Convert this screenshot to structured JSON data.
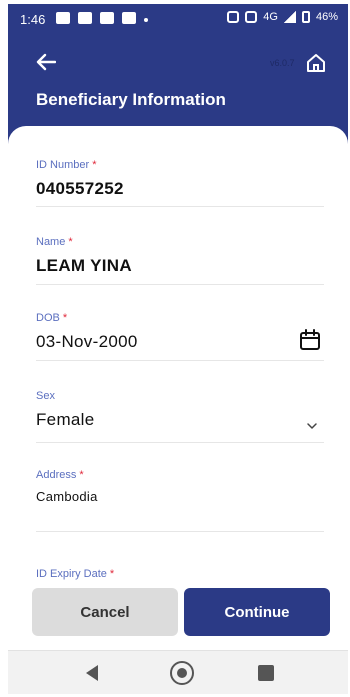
{
  "status": {
    "time": "1:46",
    "signal_text": "4G",
    "battery_text": "46%"
  },
  "appbar": {
    "version": "v6.0.7",
    "title": "Beneficiary Information"
  },
  "fields": {
    "id_number": {
      "label": "ID Number",
      "required": "*",
      "value": "040557252"
    },
    "name": {
      "label": "Name",
      "required": "*",
      "value": "LEAM YINA"
    },
    "dob": {
      "label": "DOB",
      "required": "*",
      "value": "03-Nov-2000"
    },
    "sex": {
      "label": "Sex",
      "value": "Female"
    },
    "address": {
      "label": "Address",
      "required": "*",
      "value": "Cambodia"
    },
    "id_expiry": {
      "label": "ID Expiry Date",
      "required": "*"
    }
  },
  "buttons": {
    "cancel": "Cancel",
    "continue": "Continue"
  },
  "icons": {
    "back": "arrow-left-icon",
    "home": "home-icon",
    "calendar": "calendar-icon",
    "dropdown": "chevron-down-icon"
  },
  "colors": {
    "primary": "#2b3a86",
    "label": "#5b6fbf",
    "required": "#e0283a",
    "cancel_bg": "#dcdcdc"
  }
}
